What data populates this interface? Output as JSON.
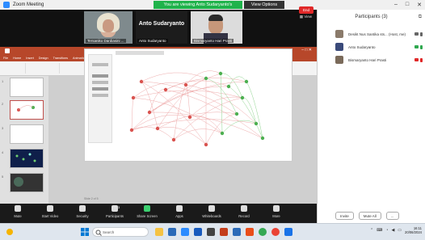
{
  "window": {
    "title": "Zoom Meeting"
  },
  "share_banner": {
    "text": "You are viewing Anto Sudaryanto's screen",
    "button": "View Options"
  },
  "video": {
    "tiles": [
      {
        "name": "Tersaniko Dardiasini ..."
      },
      {
        "name": "Anto Sudaryanto",
        "big_name": "Anto Sudaryanto"
      },
      {
        "name": "Bismaryanto Hari Prasti"
      }
    ],
    "view_label": "View"
  },
  "participants": {
    "title": "Participants (3)",
    "items": [
      {
        "name": "Desikt Nus Santika sts... (Host, me)",
        "avatar_color": "#8a7a6a",
        "mic": "#666666",
        "video": "#666666"
      },
      {
        "name": "Anto Sudaryanto",
        "avatar_color": "#3a4a7a",
        "mic": "#2fa84f",
        "video": "#2fa84f"
      },
      {
        "name": "Bismaryanto Hari Prasti",
        "avatar_color": "#7a6a5a",
        "mic": "#e02828",
        "video": "#e02828"
      }
    ],
    "invite": "Invite",
    "mute_all": "Mute All",
    "more": "..."
  },
  "ppt": {
    "title": "Presentation1 - PowerPoint",
    "tabs": [
      "File",
      "Home",
      "Insert",
      "Design",
      "Transitions",
      "Animations",
      "Slide Show",
      "Review",
      "View",
      "Help"
    ],
    "slide_numbers": [
      "1",
      "2",
      "3",
      "4",
      "5"
    ],
    "status": "Slide 2 of 5"
  },
  "toolbar": {
    "items": [
      "Mute",
      "Start Video",
      "Security",
      "Participants",
      "Share Screen",
      "Apps",
      "Whiteboards",
      "Record",
      "More"
    ],
    "end": "End",
    "participants_count": "3"
  },
  "taskbar": {
    "search_placeholder": "Search",
    "time": "16:11",
    "date": "20/06/2024"
  },
  "colors": {
    "ppt_red": "#b7472a",
    "zoom_green": "#1fb34b",
    "end_red": "#e02828",
    "graph_red": "#d9534f",
    "graph_green": "#4caf50"
  }
}
